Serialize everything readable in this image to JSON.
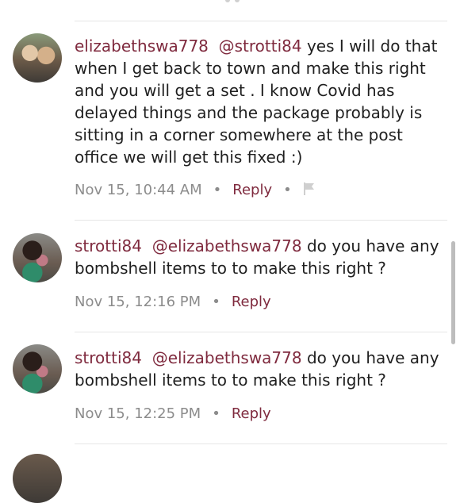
{
  "comments": [
    {
      "username": "elizabethswa778",
      "mention": "@strotti84",
      "text": "yes I will do that when I get back to town and make this right and you will get a set . I know Covid has delayed things and the package probably is sitting in a corner somewhere at the post office we will get this fixed :)",
      "timestamp": "Nov 15, 10:44 AM",
      "reply_label": "Reply",
      "separator": "•",
      "has_flag": true,
      "avatar_icon": "user-avatar"
    },
    {
      "username": "strotti84",
      "mention": "@elizabethswa778",
      "text": "do you have any bombshell items to to make this right ?",
      "timestamp": "Nov 15, 12:16 PM",
      "reply_label": "Reply",
      "separator": "•",
      "has_flag": false,
      "avatar_icon": "user-avatar"
    },
    {
      "username": "strotti84",
      "mention": "@elizabethswa778",
      "text": "do you have any bombshell items to to make this right ?",
      "timestamp": "Nov 15, 12:25 PM",
      "reply_label": "Reply",
      "separator": "•",
      "has_flag": false,
      "avatar_icon": "user-avatar"
    }
  ],
  "colors": {
    "username": "#7f2a3e",
    "meta": "#8c8c8c",
    "divider": "#e6e6e6"
  },
  "icons": {
    "flag": "flag-icon"
  }
}
